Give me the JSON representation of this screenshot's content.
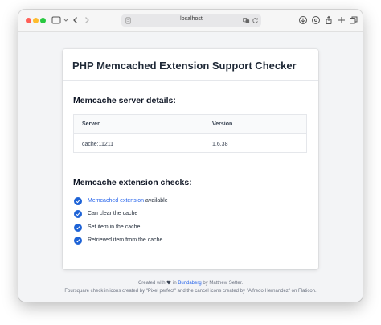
{
  "browser": {
    "url": "localhost"
  },
  "card": {
    "title": "PHP Memcached Extension Support Checker",
    "server_section_title": "Memcache server details:",
    "table": {
      "headers": [
        "Server",
        "Version"
      ],
      "rows": [
        [
          "cache:11211",
          "1.6.38"
        ]
      ]
    },
    "extension_section_title": "Memcache extension checks:",
    "checks": [
      {
        "link": "Memcached extension",
        "text": " available"
      },
      {
        "text": "Can clear the cache"
      },
      {
        "text": "Set item in the cache"
      },
      {
        "text": "Retrieved item from the cache"
      }
    ]
  },
  "footer": {
    "created_with": "Created with",
    "in": " in ",
    "location": "Bundaberg",
    "by": " by Matthew Setter.",
    "credits": "Foursquare check in icons created by \"Pixel perfect\" and the cancel icons created by \"Alfredo Hernandez\" on Flaticon."
  },
  "colors": {
    "accent": "#1e63d6",
    "link": "#2563eb"
  }
}
